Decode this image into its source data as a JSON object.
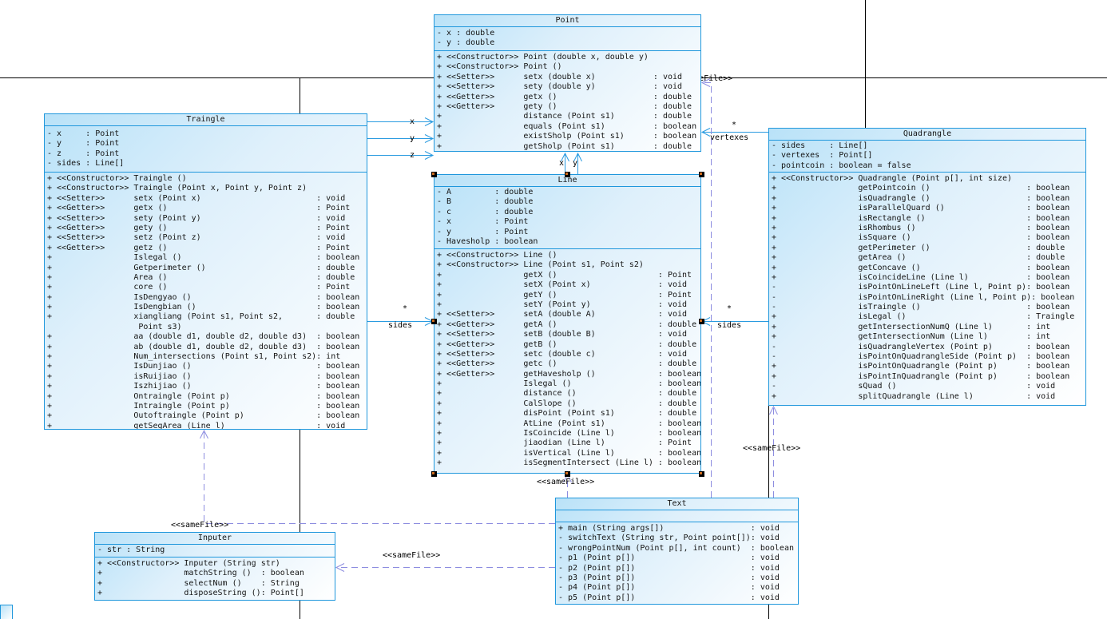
{
  "diagram": {
    "classes": {
      "point": {
        "title": "Point",
        "attributes": [
          "- x : double",
          "- y : double"
        ],
        "methods": [
          {
            "m": "+",
            "s": "<<Constructor>>",
            "n": "Point (double x, double y)",
            "t": ""
          },
          {
            "m": "+",
            "s": "<<Constructor>>",
            "n": "Point ()",
            "t": ""
          },
          {
            "m": "+",
            "s": "<<Setter>>",
            "n": "setx (double x)",
            "t": ": void"
          },
          {
            "m": "+",
            "s": "<<Setter>>",
            "n": "sety (double y)",
            "t": ": void"
          },
          {
            "m": "+",
            "s": "<<Getter>>",
            "n": "getx ()",
            "t": ": double"
          },
          {
            "m": "+",
            "s": "<<Getter>>",
            "n": "gety ()",
            "t": ": double"
          },
          {
            "m": "+",
            "s": "",
            "n": "distance (Point s1)",
            "t": ": double"
          },
          {
            "m": "+",
            "s": "",
            "n": "equals (Point s1)",
            "t": ": boolean"
          },
          {
            "m": "+",
            "s": "",
            "n": "existSholp (Point s1)",
            "t": ": boolean"
          },
          {
            "m": "+",
            "s": "",
            "n": "getSholp (Point s1)",
            "t": ": double"
          }
        ]
      },
      "traingle": {
        "title": "Traingle",
        "attributes": [
          "- x     : Point",
          "- y     : Point",
          "- z     : Point",
          "- sides : Line[]"
        ],
        "methods": [
          {
            "m": "+",
            "s": "<<Constructor>>",
            "n": "Traingle ()",
            "t": ""
          },
          {
            "m": "+",
            "s": "<<Constructor>>",
            "n": "Traingle (Point x, Point y, Point z)",
            "t": ""
          },
          {
            "m": "+",
            "s": "<<Setter>>",
            "n": "setx (Point x)",
            "t": ": void"
          },
          {
            "m": "+",
            "s": "<<Getter>>",
            "n": "getx ()",
            "t": ": Point"
          },
          {
            "m": "+",
            "s": "<<Setter>>",
            "n": "sety (Point y)",
            "t": ": void"
          },
          {
            "m": "+",
            "s": "<<Getter>>",
            "n": "gety ()",
            "t": ": Point"
          },
          {
            "m": "+",
            "s": "<<Setter>>",
            "n": "setz (Point z)",
            "t": ": void"
          },
          {
            "m": "+",
            "s": "<<Getter>>",
            "n": "getz ()",
            "t": ": Point"
          },
          {
            "m": "+",
            "s": "",
            "n": "Islegal ()",
            "t": ": boolean"
          },
          {
            "m": "+",
            "s": "",
            "n": "Getperimeter ()",
            "t": ": double"
          },
          {
            "m": "+",
            "s": "",
            "n": "Area ()",
            "t": ": double"
          },
          {
            "m": "+",
            "s": "",
            "n": "core ()",
            "t": ": Point"
          },
          {
            "m": "+",
            "s": "",
            "n": "IsDengyao ()",
            "t": ": boolean"
          },
          {
            "m": "+",
            "s": "",
            "n": "IsDengbian ()",
            "t": ": boolean"
          },
          {
            "m": "+",
            "s": "",
            "n": "xiangliang (Point s1, Point s2,",
            "t": ": double"
          },
          {
            "m": "",
            "s": "",
            "n": " Point s3)",
            "t": ""
          },
          {
            "m": "+",
            "s": "",
            "n": "aa (double d1, double d2, double d3)",
            "t": ": boolean"
          },
          {
            "m": "+",
            "s": "",
            "n": "ab (double d1, double d2, double d3)",
            "t": ": boolean"
          },
          {
            "m": "+",
            "s": "",
            "n": "Num_intersections (Point s1, Point s2)",
            "t": ": int"
          },
          {
            "m": "+",
            "s": "",
            "n": "IsDunjiao ()",
            "t": ": boolean"
          },
          {
            "m": "+",
            "s": "",
            "n": "isRuijiao ()",
            "t": ": boolean"
          },
          {
            "m": "+",
            "s": "",
            "n": "Iszhijiao ()",
            "t": ": boolean"
          },
          {
            "m": "+",
            "s": "",
            "n": "Ontraingle (Point p)",
            "t": ": boolean"
          },
          {
            "m": "+",
            "s": "",
            "n": "Intraingle (Point p)",
            "t": ": boolean"
          },
          {
            "m": "+",
            "s": "",
            "n": "Outoftraingle (Point p)",
            "t": ": boolean"
          },
          {
            "m": "+",
            "s": "",
            "n": "getSegArea (Line l)",
            "t": ": void"
          }
        ]
      },
      "line": {
        "title": "Line",
        "attributes": [
          "- A         : double",
          "- B         : double",
          "- c         : double",
          "- x         : Point",
          "- y         : Point",
          "- Havesholp : boolean"
        ],
        "methods": [
          {
            "m": "+",
            "s": "<<Constructor>>",
            "n": "Line ()",
            "t": ""
          },
          {
            "m": "+",
            "s": "<<Constructor>>",
            "n": "Line (Point s1, Point s2)",
            "t": ""
          },
          {
            "m": "+",
            "s": "",
            "n": "getX ()",
            "t": ": Point"
          },
          {
            "m": "+",
            "s": "",
            "n": "setX (Point x)",
            "t": ": void"
          },
          {
            "m": "+",
            "s": "",
            "n": "getY ()",
            "t": ": Point"
          },
          {
            "m": "+",
            "s": "",
            "n": "setY (Point y)",
            "t": ": void"
          },
          {
            "m": "+",
            "s": "<<Setter>>",
            "n": "setA (double A)",
            "t": ": void"
          },
          {
            "m": "+",
            "s": "<<Getter>>",
            "n": "getA ()",
            "t": ": double"
          },
          {
            "m": "+",
            "s": "<<Setter>>",
            "n": "setB (double B)",
            "t": ": void"
          },
          {
            "m": "+",
            "s": "<<Getter>>",
            "n": "getB ()",
            "t": ": double"
          },
          {
            "m": "+",
            "s": "<<Setter>>",
            "n": "setc (double c)",
            "t": ": void"
          },
          {
            "m": "+",
            "s": "<<Getter>>",
            "n": "getc ()",
            "t": ": double"
          },
          {
            "m": "+",
            "s": "<<Getter>>",
            "n": "getHavesholp ()",
            "t": ": boolean"
          },
          {
            "m": "+",
            "s": "",
            "n": "Islegal ()",
            "t": ": boolean"
          },
          {
            "m": "+",
            "s": "",
            "n": "distance ()",
            "t": ": double"
          },
          {
            "m": "+",
            "s": "",
            "n": "CalSlope ()",
            "t": ": double"
          },
          {
            "m": "+",
            "s": "",
            "n": "disPoint (Point s1)",
            "t": ": double"
          },
          {
            "m": "+",
            "s": "",
            "n": "AtLine (Point s1)",
            "t": ": boolean"
          },
          {
            "m": "+",
            "s": "",
            "n": "IsCoincide (Line l)",
            "t": ": boolean"
          },
          {
            "m": "+",
            "s": "",
            "n": "jiaodian (Line l)",
            "t": ": Point"
          },
          {
            "m": "+",
            "s": "",
            "n": "isVertical (Line l)",
            "t": ": boolean"
          },
          {
            "m": "+",
            "s": "",
            "n": "isSegmentIntersect (Line l)",
            "t": ": boolean"
          }
        ]
      },
      "quadrangle": {
        "title": "Quadrangle",
        "attributes": [
          "- sides     : Line[]",
          "- vertexes  : Point[]",
          "- pointcoin : boolean = false"
        ],
        "methods": [
          {
            "m": "+",
            "s": "<<Constructor>>",
            "n": "Quadrangle (Point p[], int size)",
            "t": ""
          },
          {
            "m": "+",
            "s": "",
            "n": "getPointcoin ()",
            "t": ": boolean"
          },
          {
            "m": "+",
            "s": "",
            "n": "isQuadrangle ()",
            "t": ": boolean"
          },
          {
            "m": "+",
            "s": "",
            "n": "isParallelQuard ()",
            "t": ": boolean"
          },
          {
            "m": "+",
            "s": "",
            "n": "isRectangle ()",
            "t": ": boolean"
          },
          {
            "m": "+",
            "s": "",
            "n": "isRhombus ()",
            "t": ": boolean"
          },
          {
            "m": "+",
            "s": "",
            "n": "isSquare ()",
            "t": ": boolean"
          },
          {
            "m": "+",
            "s": "",
            "n": "getPerimeter ()",
            "t": ": double"
          },
          {
            "m": "+",
            "s": "",
            "n": "getArea ()",
            "t": ": double"
          },
          {
            "m": "+",
            "s": "",
            "n": "getConcave ()",
            "t": ": boolean"
          },
          {
            "m": "+",
            "s": "",
            "n": "isCoincideLine (Line l)",
            "t": ": boolean"
          },
          {
            "m": "-",
            "s": "",
            "n": "isPointOnLineLeft (Line l, Point p)",
            "t": ": boolean"
          },
          {
            "m": "-",
            "s": "",
            "n": "isPointOnLineRight (Line l, Point p)",
            "t": ": boolean"
          },
          {
            "m": "-",
            "s": "",
            "n": "isTraingle ()",
            "t": ": boolean"
          },
          {
            "m": "+",
            "s": "",
            "n": "isLegal ()",
            "t": ": Traingle"
          },
          {
            "m": "+",
            "s": "",
            "n": "getIntersectionNumQ (Line l)",
            "t": ": int"
          },
          {
            "m": "+",
            "s": "",
            "n": "getIntersectionNum (Line l)",
            "t": ": int"
          },
          {
            "m": "-",
            "s": "",
            "n": "isQuadrangleVertex (Point p)",
            "t": ": boolean"
          },
          {
            "m": "-",
            "s": "",
            "n": "isPointOnQuadrangleSide (Point p)",
            "t": ": boolean"
          },
          {
            "m": "+",
            "s": "",
            "n": "isPointOnQuadrangle (Point p)",
            "t": ": boolean"
          },
          {
            "m": "+",
            "s": "",
            "n": "isPointInQuadrangle (Point p)",
            "t": ": boolean"
          },
          {
            "m": "-",
            "s": "",
            "n": "sQuad ()",
            "t": ": void"
          },
          {
            "m": "+",
            "s": "",
            "n": "splitQuadrangle (Line l)",
            "t": ": void"
          }
        ]
      },
      "text": {
        "title": "Text",
        "attributes": [],
        "methods": [
          {
            "m": "+",
            "s": "",
            "n": "main (String args[])",
            "t": ": void"
          },
          {
            "m": "-",
            "s": "",
            "n": "switchText (String str, Point point[])",
            "t": ": void"
          },
          {
            "m": "-",
            "s": "",
            "n": "wrongPointNum (Point p[], int count)",
            "t": ": boolean"
          },
          {
            "m": "-",
            "s": "",
            "n": "p1 (Point p[])",
            "t": ": void"
          },
          {
            "m": "-",
            "s": "",
            "n": "p2 (Point p[])",
            "t": ": void"
          },
          {
            "m": "-",
            "s": "",
            "n": "p3 (Point p[])",
            "t": ": void"
          },
          {
            "m": "-",
            "s": "",
            "n": "p4 (Point p[])",
            "t": ": void"
          },
          {
            "m": "-",
            "s": "",
            "n": "p5 (Point p[])",
            "t": ": void"
          }
        ]
      },
      "inputer": {
        "title": "Inputer",
        "attributes": [
          "- str : String"
        ],
        "methods": [
          {
            "m": "+",
            "s": "<<Constructor>>",
            "n": "Inputer (String str)",
            "t": ""
          },
          {
            "m": "+",
            "s": "",
            "n": "matchString ()",
            "t": ": boolean"
          },
          {
            "m": "+",
            "s": "",
            "n": "selectNum ()",
            "t": ": String"
          },
          {
            "m": "+",
            "s": "",
            "n": "disposeString ()",
            "t": ": Point[]"
          }
        ]
      }
    },
    "labels": {
      "role_x": "x",
      "role_y": "y",
      "role_z": "z",
      "line_role_x": "x",
      "line_role_y": "y",
      "sides": "sides",
      "vertexes": "vertexes",
      "many": "*",
      "samefile": "<<sameFile>>"
    },
    "colors": {
      "box_border": "#1f97dc",
      "association": "#2a9be0",
      "dependency": "#8d8de0",
      "page_line": "#000000"
    }
  }
}
